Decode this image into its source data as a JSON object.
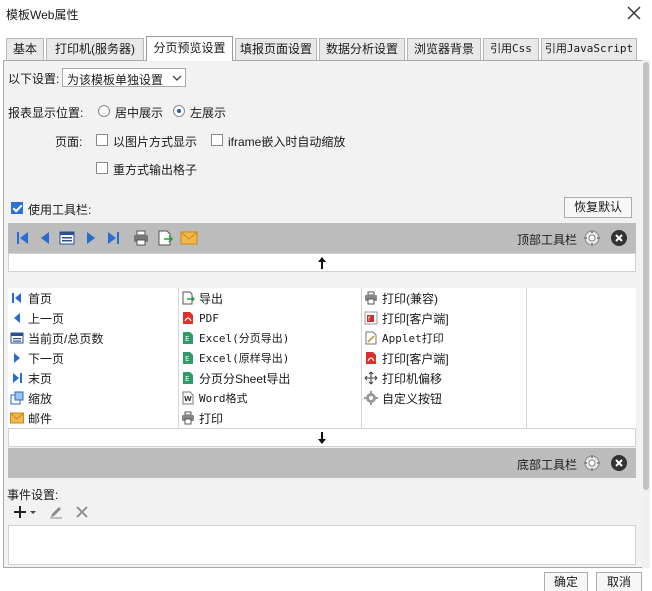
{
  "window": {
    "title": "模板Web属性"
  },
  "tabs": [
    {
      "label": "基本"
    },
    {
      "label": "打印机(服务器)"
    },
    {
      "label": "分页预览设置"
    },
    {
      "label": "填报页面设置"
    },
    {
      "label": "数据分析设置"
    },
    {
      "label": "浏览器背景"
    },
    {
      "label": "引用Css"
    },
    {
      "label": "引用JavaScript"
    }
  ],
  "settings": {
    "mode_label": "以下设置:",
    "mode_value": "为该模板单独设置",
    "position_label": "报表显示位置:",
    "position_options": [
      {
        "label": "居中展示",
        "checked": false
      },
      {
        "label": "左展示",
        "checked": true
      }
    ],
    "page_label": "页面:",
    "page_options": [
      {
        "label": "以图片方式显示",
        "checked": false
      },
      {
        "label": "iframe嵌入时自动缩放",
        "checked": false
      },
      {
        "label": "重方式输出格子",
        "checked": false
      }
    ],
    "use_toolbar_label": "使用工具栏:",
    "use_toolbar_checked": true,
    "restore_label": "恢复默认"
  },
  "top_toolbar": {
    "label": "顶部工具栏",
    "icons": [
      "first-page-icon",
      "prev-page-icon",
      "current-page-icon",
      "next-page-icon",
      "last-page-icon",
      "print-icon",
      "export-icon",
      "email-icon"
    ]
  },
  "bottom_toolbar": {
    "label": "底部工具栏"
  },
  "buttons": {
    "col1": [
      {
        "label": "首页",
        "icon": "first-page-icon"
      },
      {
        "label": "上一页",
        "icon": "prev-page-icon"
      },
      {
        "label": "当前页/总页数",
        "icon": "current-page-icon"
      },
      {
        "label": "下一页",
        "icon": "next-page-icon"
      },
      {
        "label": "末页",
        "icon": "last-page-icon"
      },
      {
        "label": "缩放",
        "icon": "zoom-icon"
      },
      {
        "label": "邮件",
        "icon": "email-icon"
      }
    ],
    "col2": [
      {
        "label": "导出",
        "icon": "export-icon"
      },
      {
        "label": "PDF",
        "icon": "pdf-icon"
      },
      {
        "label": "Excel(分页导出)",
        "icon": "excel-icon"
      },
      {
        "label": "Excel(原样导出)",
        "icon": "excel-icon"
      },
      {
        "label": "分页分Sheet导出",
        "icon": "excel-icon"
      },
      {
        "label": "Word格式",
        "icon": "word-icon"
      },
      {
        "label": "打印",
        "icon": "print-icon"
      }
    ],
    "col3": [
      {
        "label": "打印(兼容)",
        "icon": "print-icon"
      },
      {
        "label": "打印[客户端]",
        "icon": "flash-print-icon"
      },
      {
        "label": "Applet打印",
        "icon": "applet-print-icon"
      },
      {
        "label": "打印[客户端]",
        "icon": "pdf-print-icon"
      },
      {
        "label": "打印机偏移",
        "icon": "move-icon"
      },
      {
        "label": "自定义按钮",
        "icon": "gear-icon"
      }
    ]
  },
  "events": {
    "label": "事件设置:"
  },
  "footer": {
    "ok_label": "确定",
    "cancel_label": "取消"
  }
}
